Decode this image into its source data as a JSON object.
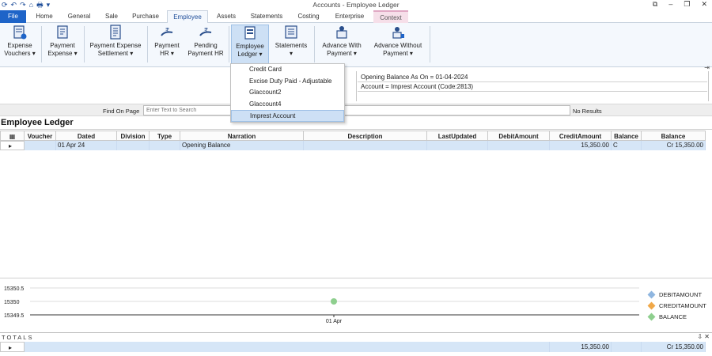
{
  "window": {
    "title": "Accounts - Employee Ledger",
    "controls": [
      "⧉",
      "–",
      "❐",
      "✕"
    ]
  },
  "qat": [
    "⟳",
    "↶",
    "↷",
    "⌂",
    "🖶",
    "▾"
  ],
  "tabs": [
    {
      "label": "File",
      "kind": "file"
    },
    {
      "label": "Home"
    },
    {
      "label": "General"
    },
    {
      "label": "Sale"
    },
    {
      "label": "Purchase"
    },
    {
      "label": "Employee",
      "kind": "active"
    },
    {
      "label": "Assets"
    },
    {
      "label": "Statements"
    },
    {
      "label": "Costing"
    },
    {
      "label": "Enterprise"
    },
    {
      "label": "Context",
      "kind": "context"
    }
  ],
  "ribbon": {
    "expense_vouchers": {
      "line1": "Expense",
      "line2": "Vouchers ▾",
      "icon": "expense-voucher-icon"
    },
    "payment_expense": {
      "line1": "Payment",
      "line2": "Expense ▾",
      "icon": "payment-expense-icon"
    },
    "payment_expense_settlement": {
      "line1": "Payment Expense",
      "line2": "Settlement ▾",
      "icon": "settlement-icon"
    },
    "payment_hr": {
      "line1": "Payment",
      "line2": "HR ▾",
      "icon": "rupee-hand-icon"
    },
    "pending_payment_hr": {
      "line1": "Pending",
      "line2": "Payment HR",
      "icon": "rupee-hand-icon"
    },
    "employee_ledger": {
      "line1": "Employee",
      "line2": "Ledger ▾",
      "icon": "ledger-icon"
    },
    "statements": {
      "line1": "Statements",
      "line2": "▾",
      "icon": "statements-icon"
    },
    "advance_with_payment": {
      "line1": "Advance With",
      "line2": "Payment ▾",
      "icon": "advance-with-icon"
    },
    "advance_without_payment": {
      "line1": "Advance Without",
      "line2": "Payment ▾",
      "icon": "advance-without-icon"
    },
    "collapse_glyph": "⇥"
  },
  "dropdown": {
    "items": [
      "Credit Card",
      "Excise Duty Paid - Adjustable",
      "Glaccount2",
      "Glaccount4",
      "Imprest Account"
    ],
    "highlighted_index": 4
  },
  "info": {
    "opening_balance": "Opening Balance As On =  01-04-2024",
    "account": "Account = Imprest Account (Code:2813)"
  },
  "find": {
    "label": "Find On Page",
    "placeholder": "Enter Text to Search",
    "result": "No Results"
  },
  "section_title": "Employee Ledger",
  "grid": {
    "columns": [
      "",
      "Voucher",
      "Dated",
      "Division",
      "Type",
      "Narration",
      "Description",
      "LastUpdated",
      "DebitAmount",
      "CreditAmount",
      "Balance",
      "Balance"
    ],
    "rows": [
      {
        "indicator": "▸",
        "voucher": "",
        "dated": "01 Apr 24",
        "division": "",
        "type": "",
        "narration": "Opening Balance",
        "description": "",
        "last_updated": "",
        "debit": "",
        "credit": "15,350.00",
        "balance_type": "C",
        "balance": "Cr 15,350.00"
      }
    ]
  },
  "chart_data": {
    "type": "line",
    "x": [
      "01 Apr"
    ],
    "yticks": [
      "15350.5",
      "15350",
      "15349.5"
    ],
    "ylim": [
      15349.5,
      15350.5
    ],
    "series": [
      {
        "name": "DEBITAMOUNT",
        "values": [
          null
        ],
        "color": "#8fb6e0"
      },
      {
        "name": "CREDITAMOUNT",
        "values": [
          null
        ],
        "color": "#f0a848"
      },
      {
        "name": "BALANCE",
        "values": [
          15350
        ],
        "color": "#8ecf8e"
      }
    ],
    "legend": "right",
    "grid": true
  },
  "totals": {
    "label": "TOTALS",
    "controls": "⇩ ✕",
    "indicator": "▸",
    "credit": "15,350.00",
    "balance": "Cr 15,350.00"
  }
}
